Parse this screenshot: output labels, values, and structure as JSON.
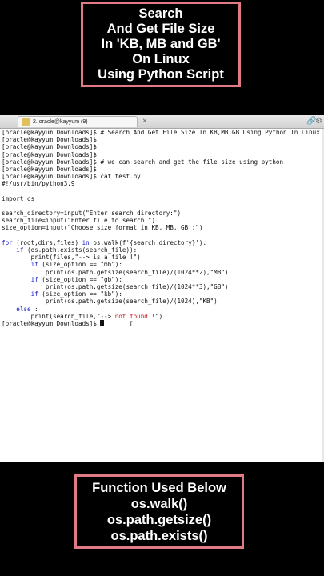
{
  "title_box": {
    "lines": [
      "Search",
      "And Get File Size",
      "In 'KB, MB and GB'",
      "On Linux",
      "Using Python Script"
    ]
  },
  "tab": {
    "label": "2. oracle@kayyum (9)",
    "icon": "terminal-tab-icon"
  },
  "prompt": "[oracle@kayyum Downloads]$ ",
  "terminal": {
    "l1_cmd": "# Search And Get File Size In KB,MB,GB Using Python In Linux",
    "l5_cmd": "# we can search and get the file size using python",
    "l7_cmd": "cat test.py",
    "shebang": "#!/usr/bin/python3.9",
    "import": "import os",
    "assign1": "search_directory=input(\"Enter search directory:\")",
    "assign2": "search_file=input(\"Enter file to search:\")",
    "assign3": "size_option=input(\"Choose size format in KB, MB, GB :\")",
    "for_kw": "for",
    "for_mid": " (root,dirs,files) ",
    "in_kw": "in",
    "for_tail": " os.walk(f'{search_directory}'):",
    "if1_kw": "if",
    "if1_tail": " (os.path.exists(search_file)):",
    "print1_fn": "print",
    "print1_tail": "(files,\"--> is a file !\")",
    "if2_kw": "if",
    "if2_tail": " (size_option == \"mb\"):",
    "print2_fn": "print",
    "print2_tail": "(os.path.getsize(search_file)/(1024**2),\"MB\")",
    "if3_kw": "if",
    "if3_tail": " (size_option == \"gb\"):",
    "print3_fn": "print",
    "print3_tail": "(os.path.getsize(search_file)/(1024**3),\"GB\")",
    "if4_kw": "if",
    "if4_tail": " (size_option == \"kb\"):",
    "print4_fn": "print",
    "print4_tail": "(os.path.getsize(search_file)/(1024),\"KB\")",
    "else_kw": "else",
    "else_tail": " :",
    "print5_fn": "print",
    "print5_head": "(search_file,\"--> ",
    "print5_red": "not found",
    "print5_tail": " !\")"
  },
  "func_box": {
    "lines": [
      "Function Used Below",
      "os.walk()",
      "os.path.getsize()",
      "os.path.exists()"
    ]
  },
  "colors": {
    "accent_border": "#e07b86",
    "keyword_blue": "#1515c8",
    "keyword_red": "#c01a1a"
  }
}
